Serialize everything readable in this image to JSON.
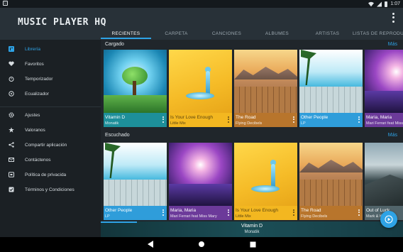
{
  "status_bar": {
    "time": "1:07"
  },
  "app": {
    "title": "MUSIC PLAYER HQ"
  },
  "tabs": [
    {
      "label": "RECIENTES",
      "active": true
    },
    {
      "label": "CARPETA",
      "active": false
    },
    {
      "label": "CANCIONES",
      "active": false
    },
    {
      "label": "ALBUMES",
      "active": false
    },
    {
      "label": "ARTISTAS",
      "active": false
    },
    {
      "label": "LISTAS DE REPRODUCCI",
      "active": false
    }
  ],
  "sidebar": {
    "items": [
      {
        "label": "Librería",
        "icon": "library-icon",
        "active": true
      },
      {
        "label": "Favoritos",
        "icon": "heart-icon",
        "active": false
      },
      {
        "label": "Temporizador",
        "icon": "timer-icon",
        "active": false
      },
      {
        "label": "Ecualizador",
        "icon": "equalizer-icon",
        "active": false
      },
      {
        "label": "Ajustes",
        "icon": "gear-icon",
        "active": false
      },
      {
        "label": "Valoranos",
        "icon": "star-icon",
        "active": false
      },
      {
        "label": "Compartir aplicación",
        "icon": "share-icon",
        "active": false
      },
      {
        "label": "Contáctenos",
        "icon": "mail-icon",
        "active": false
      },
      {
        "label": "Política de privacida",
        "icon": "shield-icon",
        "active": false
      },
      {
        "label": "Términos y Condiciones",
        "icon": "checkbox-icon",
        "active": false
      }
    ]
  },
  "sections": [
    {
      "title": "Cargado",
      "more": "Más",
      "cards": [
        {
          "title": "Vitamin D",
          "artist": "Monatik"
        },
        {
          "title": "Is Your Love Enough",
          "artist": "Little Mix"
        },
        {
          "title": "The Road",
          "artist": "Flying Decibels"
        },
        {
          "title": "Other People",
          "artist": "LP"
        },
        {
          "title": "Maria, Maria",
          "artist": "Mari Ferrari feat Miss Mary"
        }
      ]
    },
    {
      "title": "Escuchado",
      "more": "Más",
      "cards": [
        {
          "title": "Other People",
          "artist": "LP"
        },
        {
          "title": "Maria, Maria",
          "artist": "Mari Ferrari feat Miss Mary"
        },
        {
          "title": "Is Your Love Enough",
          "artist": "Little Mix"
        },
        {
          "title": "The Road",
          "artist": "Flying Decibels"
        },
        {
          "title": "Out of Luck",
          "artist": "Mark & Kev"
        }
      ]
    }
  ],
  "now_playing": {
    "title": "Vitamin D",
    "artist": "Monatik",
    "progress": 0.12
  },
  "colors": {
    "accent": "#2ea3e6",
    "sidebar_bg": "#1b2024",
    "appbar_bg": "#283138"
  }
}
